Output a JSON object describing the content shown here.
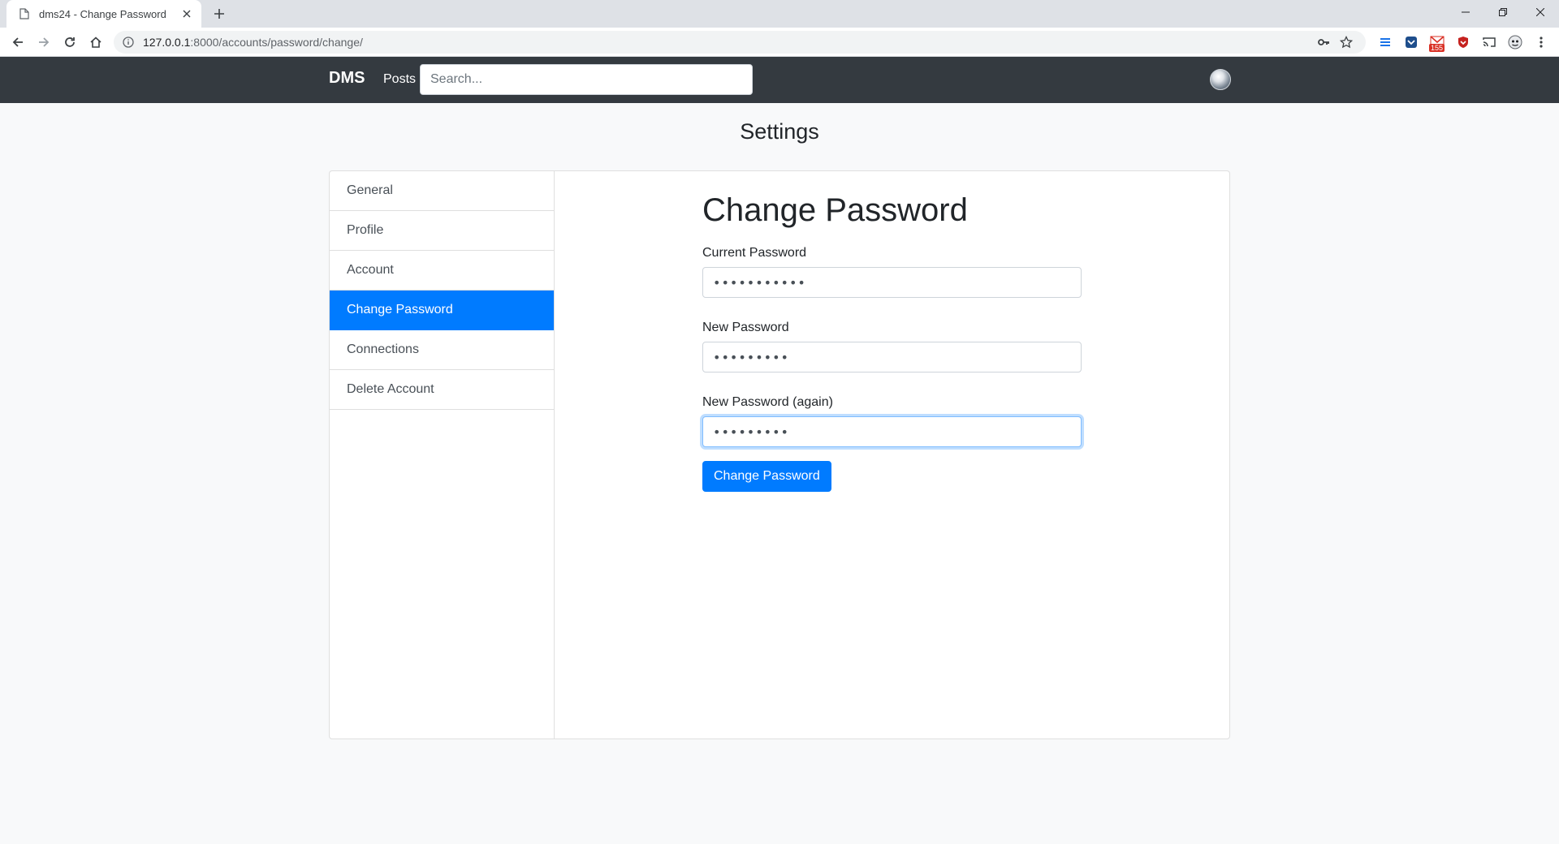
{
  "browser": {
    "tab_title": "dms24 - Change Password",
    "url_host": "127.0.0.1",
    "url_path": ":8000/accounts/password/change/",
    "extension_badge": "155"
  },
  "navbar": {
    "brand": "DMS",
    "posts_label": "Posts",
    "search_placeholder": "Search..."
  },
  "page": {
    "title": "Settings"
  },
  "sidebar": {
    "items": [
      {
        "label": "General"
      },
      {
        "label": "Profile"
      },
      {
        "label": "Account"
      },
      {
        "label": "Change Password",
        "active": true
      },
      {
        "label": "Connections"
      },
      {
        "label": "Delete Account"
      }
    ]
  },
  "form": {
    "heading": "Change Password",
    "current_label": "Current Password",
    "current_value": "•••••••••••",
    "new_label": "New Password",
    "new_value": "•••••••••",
    "again_label": "New Password (again)",
    "again_value": "•••••••••",
    "submit_label": "Change Password"
  },
  "colors": {
    "primary": "#007bff",
    "navbar_bg": "#343a40",
    "page_bg": "#f8f9fa"
  }
}
